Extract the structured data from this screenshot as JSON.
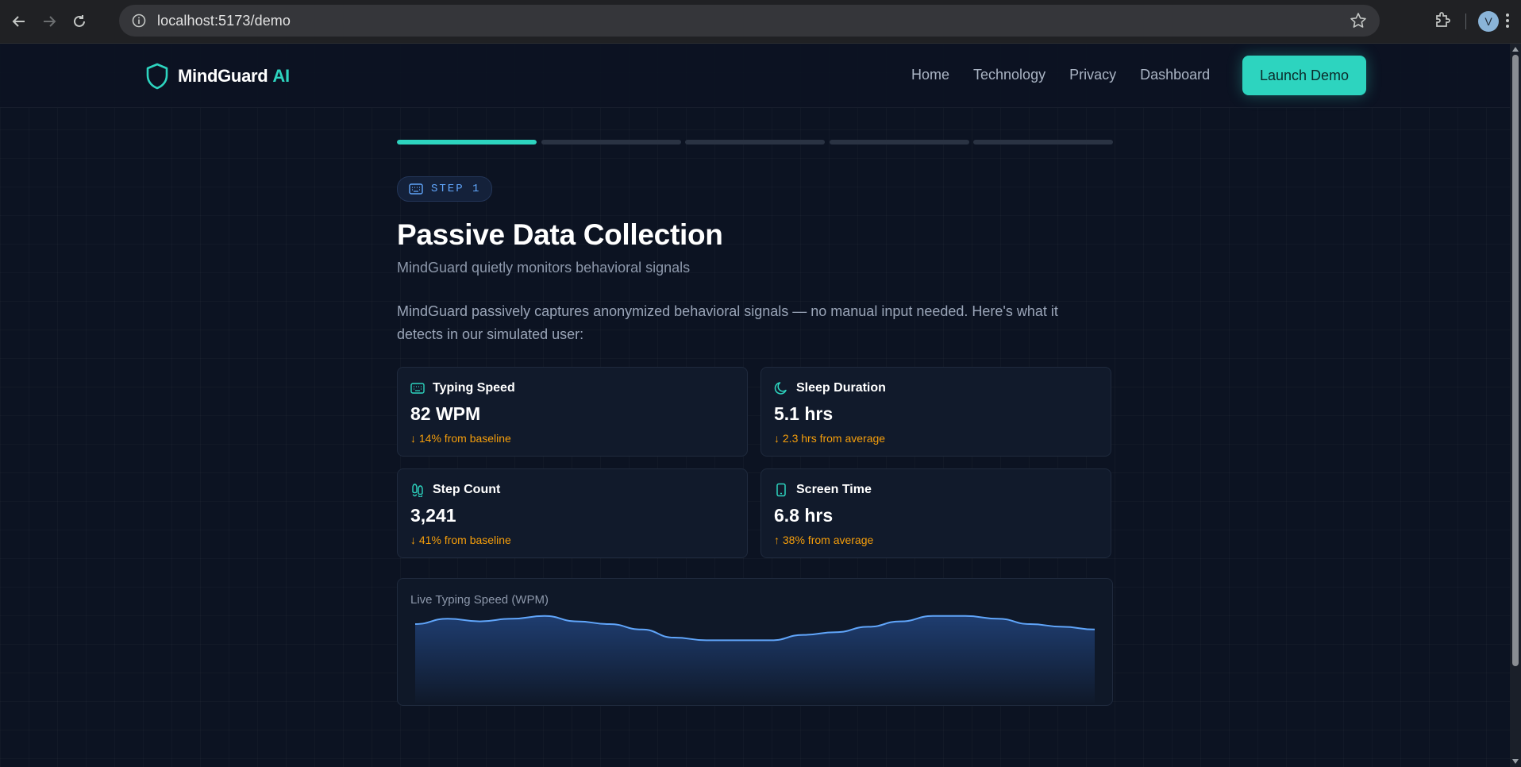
{
  "browser": {
    "url": "localhost:5173/demo",
    "profile_initial": "V"
  },
  "site": {
    "brand_name": "MindGuard",
    "brand_suffix": "AI",
    "nav": [
      "Home",
      "Technology",
      "Privacy",
      "Dashboard"
    ],
    "cta_label": "Launch Demo"
  },
  "steps": {
    "total": 5,
    "current": 1,
    "badge_label": "STEP 1"
  },
  "main": {
    "title": "Passive Data Collection",
    "subtitle": "MindGuard quietly monitors behavioral signals",
    "description": "MindGuard passively captures anonymized behavioral signals — no manual input needed. Here's what it detects in our simulated user:"
  },
  "metrics": [
    {
      "label": "Typing Speed",
      "value": "82 WPM",
      "delta": "↓ 14% from baseline",
      "icon": "keyboard-icon"
    },
    {
      "label": "Sleep Duration",
      "value": "5.1 hrs",
      "delta": "↓ 2.3 hrs from average",
      "icon": "moon-icon"
    },
    {
      "label": "Step Count",
      "value": "3,241",
      "delta": "↓ 41% from baseline",
      "icon": "footprints-icon"
    },
    {
      "label": "Screen Time",
      "value": "6.8 hrs",
      "delta": "↑ 38% from average",
      "icon": "smartphone-icon"
    }
  ],
  "colors": {
    "accent": "#2dd4bf",
    "blue": "#60a5fa",
    "warning": "#f59e0b",
    "background": "#0c1322"
  },
  "chart_data": {
    "type": "area",
    "title": "Live Typing Speed (WPM)",
    "xlabel": "",
    "ylabel": "",
    "x": [
      0,
      1,
      2,
      3,
      4,
      5,
      6,
      7,
      8,
      9,
      10,
      11,
      12,
      13,
      14,
      15,
      16,
      17,
      18,
      19,
      20,
      21
    ],
    "values": [
      90,
      92,
      91,
      92,
      93,
      91,
      90,
      88,
      85,
      84,
      84,
      84,
      86,
      87,
      89,
      91,
      93,
      93,
      92,
      90,
      89,
      88
    ],
    "ylim": [
      60,
      95
    ],
    "grid": false,
    "legend": "none"
  }
}
